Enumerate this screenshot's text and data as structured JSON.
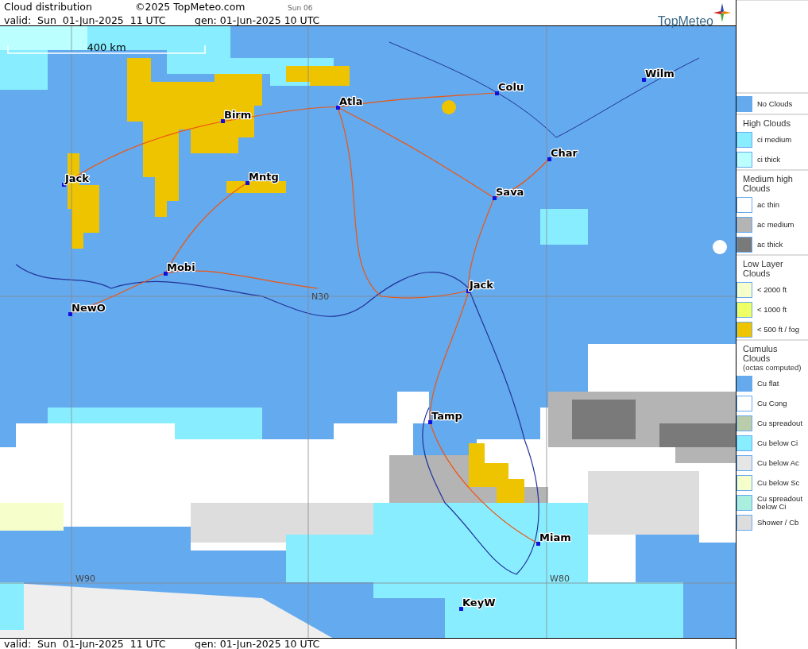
{
  "header": {
    "title": "Cloud distribution",
    "copyright": "©2025 TopMeteo.com",
    "day_tab": "Sun 06",
    "valid": "valid:  Sun  01-Jun-2025  11 UTC",
    "generated": "gen: 01-Jun-2025 10 UTC",
    "logo": "TopMeteo"
  },
  "map": {
    "scale": "400 km",
    "grid_labels": [
      "N30",
      "W90",
      "W80"
    ],
    "cities": [
      {
        "name": "Wilm"
      },
      {
        "name": "Colu"
      },
      {
        "name": "Atla"
      },
      {
        "name": "Birm"
      },
      {
        "name": "Char"
      },
      {
        "name": "Sava"
      },
      {
        "name": "Mntg"
      },
      {
        "name": "Jack"
      },
      {
        "name": "Mobi"
      },
      {
        "name": "NewO"
      },
      {
        "name": "Jack"
      },
      {
        "name": "Tamp"
      },
      {
        "name": "Miam"
      },
      {
        "name": "KeyW"
      }
    ]
  },
  "legend": [
    {
      "kind": "item",
      "label": "No Clouds",
      "color": "#66aaee"
    },
    {
      "kind": "heading",
      "label": "High Clouds"
    },
    {
      "kind": "item",
      "label": "ci medium",
      "color": "#88eeff"
    },
    {
      "kind": "item",
      "label": "ci thick",
      "color": "#bbffff"
    },
    {
      "kind": "heading",
      "label": "Medium high Clouds"
    },
    {
      "kind": "item",
      "label": "ac thin",
      "color": "#ffffff"
    },
    {
      "kind": "item",
      "label": "ac medium",
      "color": "#b4b4b4"
    },
    {
      "kind": "item",
      "label": "ac thick",
      "color": "#7a7a7a"
    },
    {
      "kind": "heading",
      "label": "Low Layer Clouds"
    },
    {
      "kind": "item",
      "label": "< 2000 ft",
      "color": "#f6ffcc"
    },
    {
      "kind": "item",
      "label": "< 1000 ft",
      "color": "#eeff66"
    },
    {
      "kind": "item",
      "label": "< 500 ft / fog",
      "color": "#eec400"
    },
    {
      "kind": "heading",
      "label": "Cumulus Clouds",
      "note": "(octas computed)"
    },
    {
      "kind": "item",
      "label": "Cu flat",
      "color": "#66aaee"
    },
    {
      "kind": "item",
      "label": "Cu Cong",
      "color": "#ffffff"
    },
    {
      "kind": "item",
      "label": "Cu spreadout",
      "color": "#bbccaa"
    },
    {
      "kind": "item",
      "label": "Cu below Ci",
      "color": "#88eeff"
    },
    {
      "kind": "item",
      "label": "Cu below Ac",
      "color": "#e6e6e6"
    },
    {
      "kind": "item",
      "label": "Cu below Sc",
      "color": "#f6ffcc"
    },
    {
      "kind": "item",
      "label": "Cu spreadout below Ci",
      "color": "#aaeedd"
    },
    {
      "kind": "item",
      "label": "Shower / Cb",
      "color": "#dddddd"
    }
  ],
  "footer": {
    "valid": "valid:  Sun  01-Jun-2025  11 UTC",
    "generated": "gen: 01-Jun-2025 10 UTC"
  }
}
